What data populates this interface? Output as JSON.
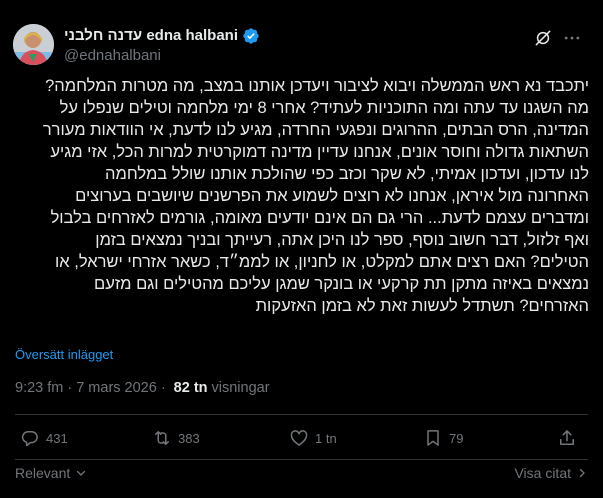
{
  "author": {
    "display_name": "עדנה חלבני edna halbani",
    "handle": "@ednahalbani",
    "verified": true
  },
  "tweet": {
    "lines": [
      "יתכבד נא ראש הממשלה ויבוא לציבור ויעדכן אותנו במצב, מה מטרות המלחמה?",
      "מה השגנו עד עתה ומה התוכניות לעתיד? אחרי 8 ימי מלחמה וטילים שנפלו על",
      "המדינה, הרס הבתים, ההרוגים ונפגעי החרדה, מגיע לנו לדעת, אי הוודאות מעורר",
      "השתאות גדולה וחוסר אונים, אנחנו עדיין מדינה דמוקרטית למרות הכל, אזי מגיע",
      "לנו עדכון, ועדכון אמיתי, לא שקר וכזב כפי שהולכת אותנו שולל במלחמה",
      "האחרונה מול  איראן,  אנחנו לא רוצים לשמוע את הפרשנים שיושבים בערוצים",
      "ומדברים עצמם לדעת... הרי גם הם אינם יודעים  מאומה, גורמים לאזרחים בלבול",
      "ואף זלזול, דבר חשוב נוסף, ספר לנו היכן אתה, רעייתך ובניך נמצאים בזמן",
      "הטילים? האם רצים אתם למקלט, או לחניון, או לממ״ד, כשאר אזרחי ישראל, או",
      "נמצאים באיזה מתקן תת קרקעי או בונקר שמגן עליכם מהטילים וגם מזעם",
      "האזרחים? תשתדל לעשות זאת לא בזמן האזעקות"
    ],
    "translate_label": "Översätt inlägget",
    "time": "9:23 fm",
    "date": "7 mars 2026",
    "views_count": "82 tn",
    "views_label": "visningar"
  },
  "actions": {
    "reply_count": "431",
    "repost_count": "383",
    "like_count": "1 tn",
    "bookmark_count": "79"
  },
  "footer": {
    "sort_label": "Relevant",
    "quotes_label": "Visa citat"
  },
  "colors": {
    "background": "#000000",
    "text": "#e7e9ea",
    "muted": "#71767b",
    "accent": "#1d9bf0"
  },
  "icons": [
    "verified-badge-icon",
    "grok-icon",
    "more-icon",
    "reply-icon",
    "repost-icon",
    "like-icon",
    "bookmark-icon",
    "share-icon",
    "chevron-down-icon"
  ]
}
